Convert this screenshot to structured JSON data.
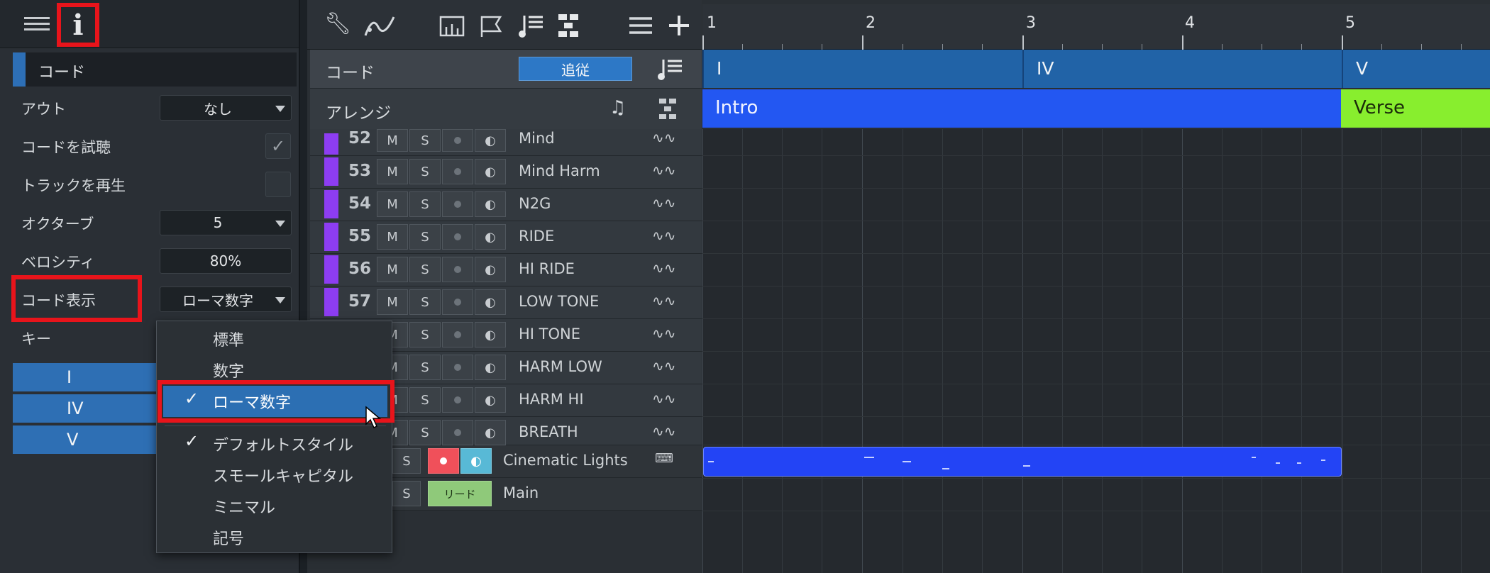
{
  "inspector": {
    "section_title": "コード",
    "rows": [
      {
        "label": "アウト",
        "value": "なし"
      },
      {
        "label": "コードを試聴"
      },
      {
        "label": "トラックを再生"
      },
      {
        "label": "オクターブ",
        "value": "5"
      },
      {
        "label": "ベロシティ",
        "value": "80%"
      },
      {
        "label": "コード表示",
        "value": "ローマ数字"
      },
      {
        "label": "キー"
      }
    ],
    "check_mark": "✓",
    "key_chords": [
      "I",
      "IV",
      "V"
    ]
  },
  "toolbar": {
    "icons": [
      "wrench-icon",
      "curve-tool-icon",
      "mixer-icon",
      "flag-icon",
      "chord-track-icon",
      "arranger-icon",
      "list-icon",
      "add-icon"
    ]
  },
  "ruler": {
    "bars": [
      "1",
      "2",
      "3",
      "4",
      "5"
    ]
  },
  "lanes": {
    "chord_label": "コード",
    "follow_button": "追従",
    "arrange_label": "アレンジ",
    "chords": [
      "I",
      "IV",
      "V"
    ],
    "sections": [
      "Intro",
      "Verse"
    ]
  },
  "tracks": [
    {
      "num": "52",
      "name": "Mind"
    },
    {
      "num": "53",
      "name": "Mind Harm"
    },
    {
      "num": "54",
      "name": "N2G"
    },
    {
      "num": "55",
      "name": "RIDE"
    },
    {
      "num": "56",
      "name": "HI RIDE"
    },
    {
      "num": "57",
      "name": "LOW TONE"
    },
    {
      "num": "",
      "name": "HI TONE"
    },
    {
      "num": "",
      "name": "HARM LOW"
    },
    {
      "num": "",
      "name": "HARM HI"
    },
    {
      "num": "",
      "name": "BREATH"
    },
    {
      "num": "",
      "name": "Cinematic Lights"
    },
    {
      "num": "",
      "name": "Main",
      "badge": "リード"
    }
  ],
  "track_buttons": {
    "mute": "M",
    "solo": "S"
  },
  "dropdown": {
    "items": [
      "標準",
      "数字",
      "ローマ数字",
      "デフォルトスタイル",
      "スモールキャピタル",
      "ミニマル",
      "記号"
    ],
    "selected": "ローマ数字",
    "checked": [
      "ローマ数字",
      "デフォルトスタイル"
    ]
  }
}
